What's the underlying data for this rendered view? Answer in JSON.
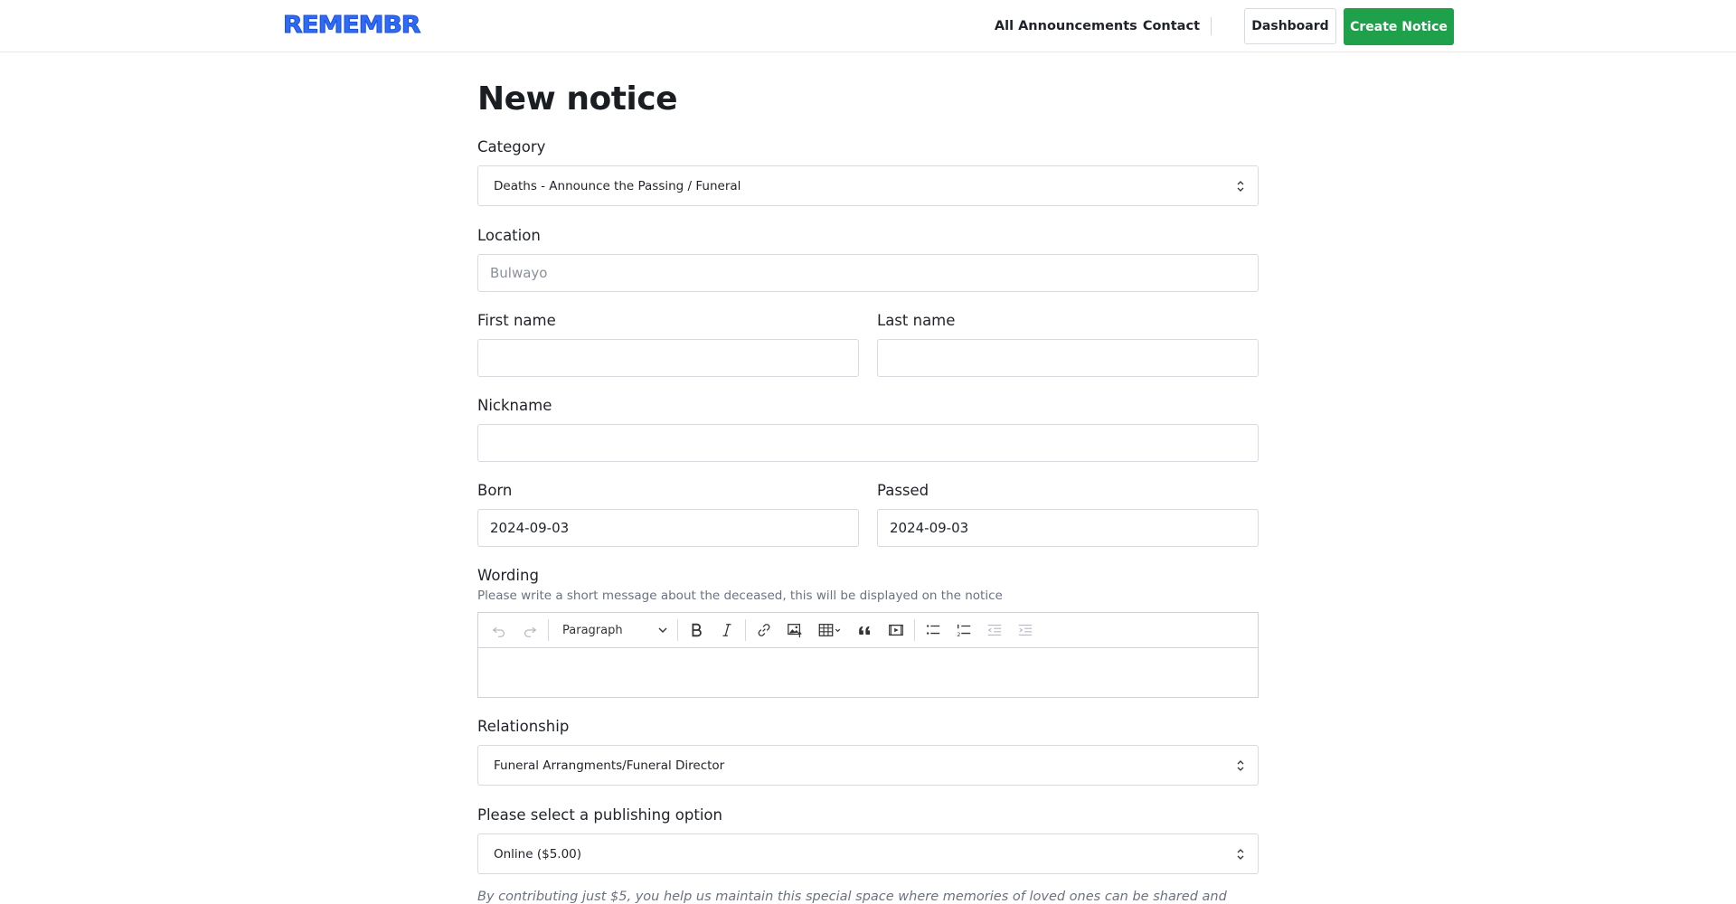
{
  "header": {
    "logo": "REMEMBR",
    "nav": {
      "announcements": "All Announcements",
      "contact": "Contact",
      "dashboard": "Dashboard",
      "create": "Create Notice"
    }
  },
  "form": {
    "title": "New notice",
    "category": {
      "label": "Category",
      "value": "Deaths - Announce the Passing / Funeral"
    },
    "location": {
      "label": "Location",
      "placeholder": "Bulwayo"
    },
    "first_name": {
      "label": "First name",
      "value": ""
    },
    "last_name": {
      "label": "Last name",
      "value": ""
    },
    "nickname": {
      "label": "Nickname",
      "value": ""
    },
    "born": {
      "label": "Born",
      "value": "2024-09-03"
    },
    "passed": {
      "label": "Passed",
      "value": "2024-09-03"
    },
    "wording": {
      "label": "Wording",
      "hint": "Please write a short message about the deceased, this will be displayed on the notice",
      "toolbar": {
        "paragraph": "Paragraph",
        "icons": [
          "undo-icon",
          "redo-icon",
          "bold-icon",
          "italic-icon",
          "link-icon",
          "image-upload-icon",
          "table-icon",
          "blockquote-icon",
          "media-embed-icon",
          "bulleted-list-icon",
          "numbered-list-icon",
          "outdent-icon",
          "indent-icon"
        ]
      },
      "content": ""
    },
    "relationship": {
      "label": "Relationship",
      "value": "Funeral Arrangments/Funeral Director"
    },
    "publishing": {
      "label": "Please select a publishing option",
      "value": "Online ($5.00)"
    },
    "contribution_note": "By contributing just $5, you help us maintain this special space where memories of loved ones can be shared and"
  },
  "colors": {
    "brand": "#2f6cf6",
    "create_button": "#1fa04b",
    "border": "#d7dbe0"
  }
}
